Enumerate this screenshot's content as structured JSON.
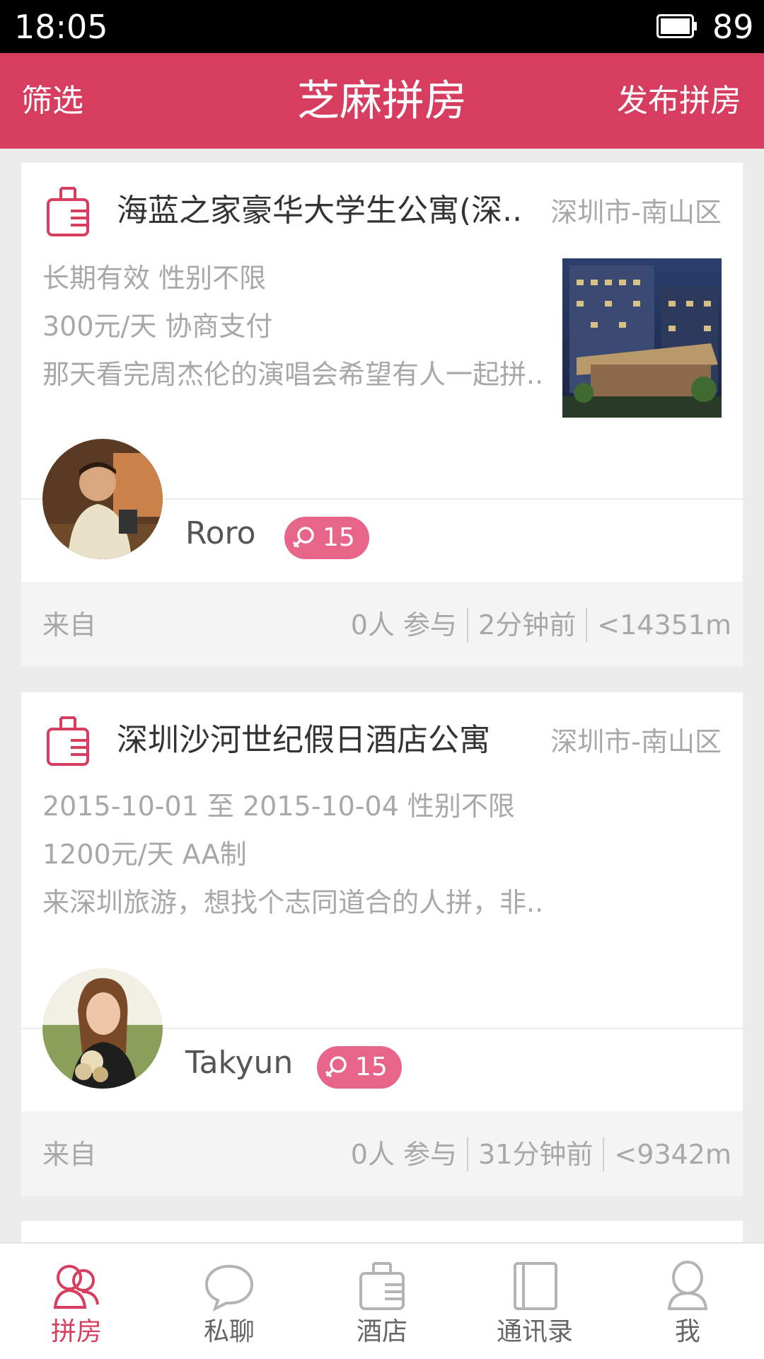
{
  "status_bar": {
    "time": "18:05",
    "battery": "89"
  },
  "app_bar": {
    "filter_label": "筛选",
    "title": "芝麻拼房",
    "publish_label": "发布拼房"
  },
  "colors": {
    "accent": "#d63d5f",
    "badge": "#e8658a"
  },
  "cards": [
    {
      "title": "海蓝之家豪华大学生公寓(深..",
      "location": "深圳市-南山区",
      "line1": "长期有效 性别不限",
      "line2": "300元/天 协商支付",
      "line3": "那天看完周杰伦的演唱会希望有人一起拼..",
      "has_photo": true,
      "username": "Roro",
      "badge_count": "15",
      "from_label": "来自",
      "participants": "0人 参与",
      "time_ago": "2分钟前",
      "distance": "<14351m"
    },
    {
      "title": "深圳沙河世纪假日酒店公寓",
      "location": "深圳市-南山区",
      "line1": "2015-10-01 至 2015-10-04 性别不限",
      "line2": "1200元/天 AA制",
      "line3": "来深圳旅游，想找个志同道合的人拼，非..",
      "has_photo": false,
      "username": "Takyun",
      "badge_count": "15",
      "from_label": "来自",
      "participants": "0人 参与",
      "time_ago": "31分钟前",
      "distance": "<9342m"
    }
  ],
  "nav": [
    {
      "label": "拼房",
      "icon": "roommates-icon",
      "active": true
    },
    {
      "label": "私聊",
      "icon": "chat-bubble-icon",
      "active": false
    },
    {
      "label": "酒店",
      "icon": "hotel-luggage-icon",
      "active": false
    },
    {
      "label": "通讯录",
      "icon": "contacts-book-icon",
      "active": false
    },
    {
      "label": "我",
      "icon": "profile-icon",
      "active": false
    }
  ]
}
